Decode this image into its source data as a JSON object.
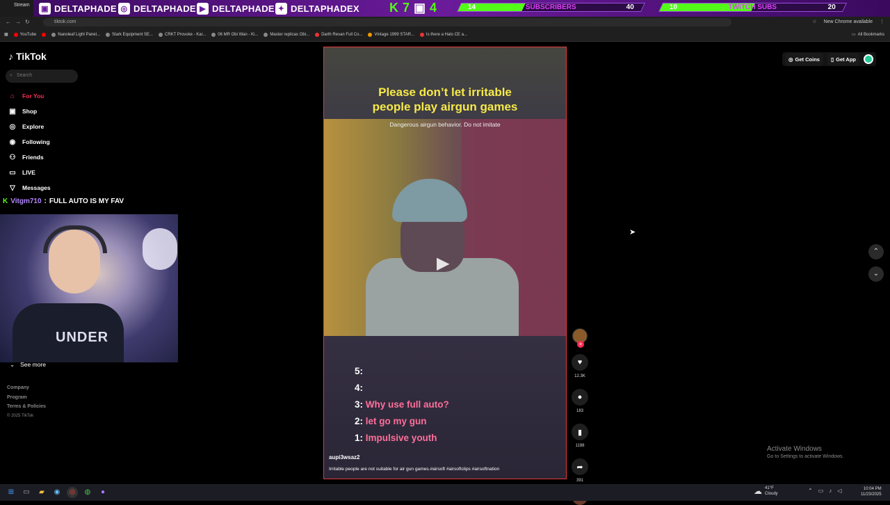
{
  "overlay": {
    "tab_label": "Stream",
    "socials": [
      {
        "icon": "twitch-icon",
        "handle": "DELTAPHADE"
      },
      {
        "icon": "instagram-icon",
        "handle": "DELTAPHADE"
      },
      {
        "icon": "youtube-icon",
        "handle": "DELTAPHADE"
      },
      {
        "icon": "twitter-icon",
        "handle": "DELTAPHADEX"
      }
    ],
    "kick_count": "7",
    "twitch_count": "4",
    "subs_goal": {
      "current": "14",
      "label": "SUBSCRIBERS",
      "target": "40",
      "progress": 0.35
    },
    "twitch_goal": {
      "current": "10",
      "label": "TWITCH SUBS",
      "target": "20",
      "progress": 0.5
    },
    "accent": "#53fc18"
  },
  "browser": {
    "url": "tiktok.com",
    "update_label": "New Chrome available",
    "bookmarks": [
      "YouTube",
      "",
      "Nanoleaf Light Panel...",
      "Stark Equipment SE...",
      "CRKT Provoke - Kar...",
      "06 MR Obi Wan - Ki...",
      "Master replicas Obi...",
      "Darth Revan Full Co...",
      "Vintage 1999 STAR...",
      "Is there a Halo CE a..."
    ],
    "all_bookmarks": "All Bookmarks"
  },
  "tiktok": {
    "brand": "TikTok",
    "search_placeholder": "Search",
    "nav": [
      {
        "label": "For You",
        "icon": "home-icon",
        "active": true
      },
      {
        "label": "Shop",
        "icon": "shop-icon"
      },
      {
        "label": "Explore",
        "icon": "compass-icon"
      },
      {
        "label": "Following",
        "icon": "following-icon"
      },
      {
        "label": "Friends",
        "icon": "friends-icon"
      },
      {
        "label": "LIVE",
        "icon": "live-icon"
      },
      {
        "label": "Messages",
        "icon": "messages-icon"
      }
    ],
    "see_more": "See more",
    "footer": [
      "Company",
      "Program",
      "Terms & Policies"
    ],
    "copyright": "© 2025 TikTok",
    "get_coins": "Get Coins",
    "get_app": "Get App"
  },
  "chat": {
    "user": "Vitgm710",
    "separator": ":",
    "message": "FULL AUTO IS MY FAV"
  },
  "webcam": {
    "shirt_text": "UNDER"
  },
  "video": {
    "title_line1": "Please don’t let irritable",
    "title_line2": "people play airgun games",
    "subtitle": "Dangerous airgun behavior. Do not imitate",
    "list": [
      {
        "num": "5:",
        "text": ""
      },
      {
        "num": "4:",
        "text": ""
      },
      {
        "num": "3:",
        "text": "Why use full auto?"
      },
      {
        "num": "2:",
        "text": "let go my gun"
      },
      {
        "num": "1:",
        "text": "Impulsive youth"
      }
    ],
    "author": "aupi3wsaz2",
    "description": "Irritable people are not suitable for air gun games.#airsoft #airsoftclips #airsoftnation"
  },
  "actions": {
    "likes": "12.3K",
    "comments": "183",
    "saves": "1198",
    "shares": "391"
  },
  "windows": {
    "activate_title": "Activate Windows",
    "activate_sub": "Go to Settings to activate Windows.",
    "weather_temp": "41°F",
    "weather_desc": "Cloudy",
    "time": "10:04 PM",
    "date": "11/23/2025"
  }
}
